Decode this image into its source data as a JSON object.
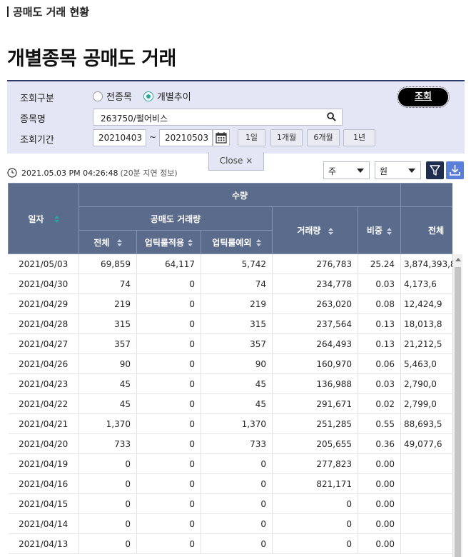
{
  "breadcrumb": "공매도 거래 현황",
  "page_title": "개별종목 공매도 거래",
  "search": {
    "type_label": "조회구분",
    "type_options": [
      "전종목",
      "개별추이"
    ],
    "type_selected": "개별추이",
    "stock_label": "종목명",
    "stock_value": "263750/펄어비스",
    "period_label": "조회기간",
    "date_from": "20210403",
    "tilde": "~",
    "date_to": "20210503",
    "period_buttons": [
      "1일",
      "1개월",
      "6개월",
      "1년"
    ],
    "submit_label": "조회",
    "close_label": "Close ×"
  },
  "status": {
    "timestamp": "2021.05.03 PM 04:26:48",
    "note": "(20분 지연 정보)"
  },
  "filters": {
    "period_select": "주",
    "unit_select": "원"
  },
  "table": {
    "header_quantity": "수량",
    "header_date": "일자",
    "header_short_volume": "공매도 거래량",
    "header_total": "전체",
    "header_uptick_applied": "업틱룰적용",
    "header_uptick_exempt": "업틱룰예외",
    "header_volume": "거래량",
    "header_ratio": "비중",
    "header_amount_total": "전체",
    "rows": [
      [
        "2021/05/03",
        "69,859",
        "64,117",
        "5,742",
        "276,783",
        "25.24",
        "3,874,393,8"
      ],
      [
        "2021/04/30",
        "74",
        "0",
        "74",
        "234,778",
        "0.03",
        "4,173,6"
      ],
      [
        "2021/04/29",
        "219",
        "0",
        "219",
        "263,020",
        "0.08",
        "12,424,9"
      ],
      [
        "2021/04/28",
        "315",
        "0",
        "315",
        "237,564",
        "0.13",
        "18,013,8"
      ],
      [
        "2021/04/27",
        "357",
        "0",
        "357",
        "264,493",
        "0.13",
        "21,212,5"
      ],
      [
        "2021/04/26",
        "90",
        "0",
        "90",
        "160,970",
        "0.06",
        "5,463,0"
      ],
      [
        "2021/04/23",
        "45",
        "0",
        "45",
        "136,988",
        "0.03",
        "2,790,0"
      ],
      [
        "2021/04/22",
        "45",
        "0",
        "45",
        "291,671",
        "0.02",
        "2,799,0"
      ],
      [
        "2021/04/21",
        "1,370",
        "0",
        "1,370",
        "251,285",
        "0.55",
        "88,693,5"
      ],
      [
        "2021/04/20",
        "733",
        "0",
        "733",
        "205,655",
        "0.36",
        "49,077,6"
      ],
      [
        "2021/04/19",
        "0",
        "0",
        "0",
        "277,823",
        "0.00",
        ""
      ],
      [
        "2021/04/16",
        "0",
        "0",
        "0",
        "821,171",
        "0.00",
        ""
      ],
      [
        "2021/04/15",
        "0",
        "0",
        "0",
        "0",
        "0.00",
        ""
      ],
      [
        "2021/04/14",
        "0",
        "0",
        "0",
        "0",
        "0.00",
        ""
      ],
      [
        "2021/04/13",
        "0",
        "0",
        "0",
        "0",
        "0.00",
        ""
      ]
    ]
  },
  "colors": {
    "header_bg": "#5b6b8c",
    "panel_bg": "#e4e6f5",
    "accent": "#2aa7a0",
    "filter_btn": "#1f2d4f",
    "download_btn": "#5b7fd8"
  }
}
